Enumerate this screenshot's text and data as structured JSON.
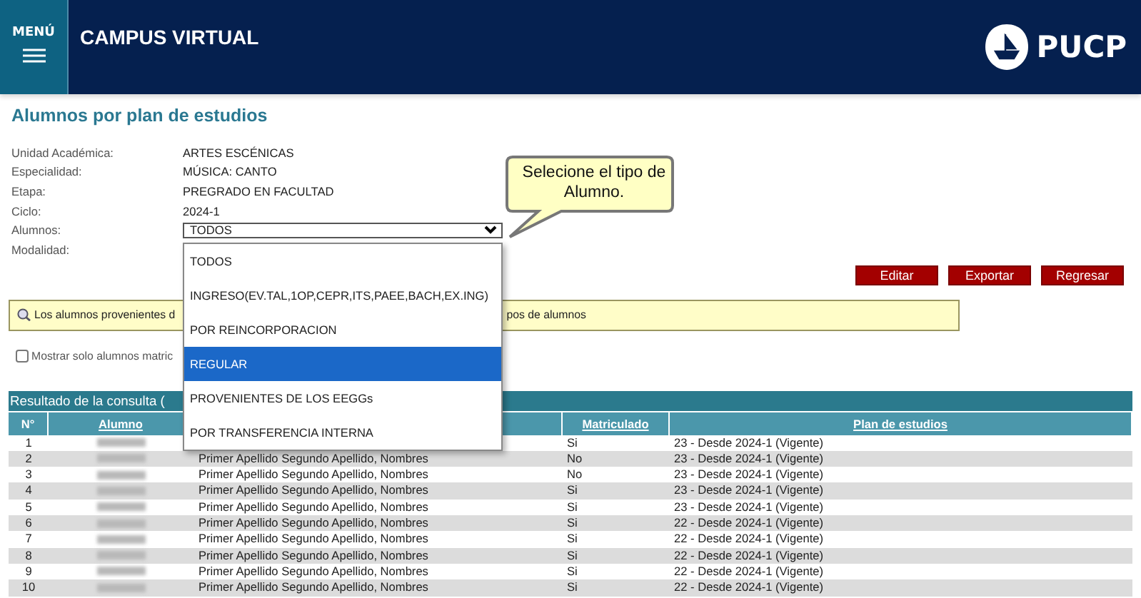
{
  "header": {
    "menu_label": "MENÚ",
    "title": "CAMPUS VIRTUAL",
    "logo_text": "PUCP"
  },
  "page_title": "Alumnos por plan de estudios",
  "fields": [
    {
      "kind": "text",
      "label": "Unidad Académica:",
      "value": "ARTES ESCÉNICAS"
    },
    {
      "kind": "text",
      "label": "Especialidad:",
      "value": "MÚSICA: CANTO"
    },
    {
      "kind": "text",
      "label": "Etapa:",
      "value": "PREGRADO EN FACULTAD"
    },
    {
      "kind": "text",
      "label": "Ciclo:",
      "value": "2024-1"
    },
    {
      "kind": "select",
      "label": "Alumnos:",
      "value": "TODOS"
    },
    {
      "kind": "text",
      "label": "Modalidad:"
    }
  ],
  "dropdown": {
    "options": [
      {
        "label": "TODOS",
        "selected": false
      },
      {
        "label": "INGRESO(EV.TAL,1OP,CEPR,ITS,PAEE,BACH,EX.ING)",
        "selected": false
      },
      {
        "label": "POR REINCORPORACION",
        "selected": false
      },
      {
        "label": "REGULAR",
        "selected": true
      },
      {
        "label": "PROVENIENTES DE LOS EEGGs",
        "selected": false
      },
      {
        "label": "POR TRANSFERENCIA INTERNA",
        "selected": false
      }
    ]
  },
  "callout": "Selecione el tipo de Alumno.",
  "buttons": [
    "Editar",
    "Exportar",
    "Regresar"
  ],
  "info": {
    "text_start": "Los alumnos provenientes d",
    "text_end": "pos de alumnos"
  },
  "filter": {
    "label": "Mostrar solo alumnos matric",
    "checked": false
  },
  "results": {
    "title": "Resultado de la consulta (",
    "columns": [
      {
        "label": "N°",
        "sortable": false
      },
      {
        "label": "Alumno",
        "sortable": true
      },
      {
        "label": "Matriculado",
        "sortable": true
      },
      {
        "label": "Plan de estudios",
        "sortable": true
      }
    ],
    "rows": [
      {
        "n": "1",
        "matriculado": "Si",
        "plan": "23 - Desde 2024-1 (Vigente)"
      },
      {
        "n": "2",
        "name": "Primer Apellido Segundo Apellido, Nombres",
        "matriculado": "No",
        "plan": "23 - Desde 2024-1 (Vigente)"
      },
      {
        "n": "3",
        "name": "Primer Apellido Segundo Apellido, Nombres",
        "matriculado": "No",
        "plan": "23 - Desde 2024-1 (Vigente)"
      },
      {
        "n": "4",
        "name": "Primer Apellido Segundo Apellido, Nombres",
        "matriculado": "Si",
        "plan": "23 - Desde 2024-1 (Vigente)"
      },
      {
        "n": "5",
        "name": "Primer Apellido Segundo Apellido, Nombres",
        "matriculado": "Si",
        "plan": "23 - Desde 2024-1 (Vigente)"
      },
      {
        "n": "6",
        "name": "Primer Apellido Segundo Apellido, Nombres",
        "matriculado": "Si",
        "plan": "22 - Desde 2024-1 (Vigente)"
      },
      {
        "n": "7",
        "name": "Primer Apellido Segundo Apellido, Nombres",
        "matriculado": "Si",
        "plan": "22 - Desde 2024-1 (Vigente)"
      },
      {
        "n": "8",
        "name": "Primer Apellido Segundo Apellido, Nombres",
        "matriculado": "Si",
        "plan": "22 - Desde 2024-1 (Vigente)"
      },
      {
        "n": "9",
        "name": "Primer Apellido Segundo Apellido, Nombres",
        "matriculado": "Si",
        "plan": "22 - Desde 2024-1 (Vigente)"
      },
      {
        "n": "10",
        "name": "Primer Apellido Segundo Apellido, Nombres",
        "matriculado": "Si",
        "plan": "22 - Desde 2024-1 (Vigente)"
      }
    ]
  }
}
